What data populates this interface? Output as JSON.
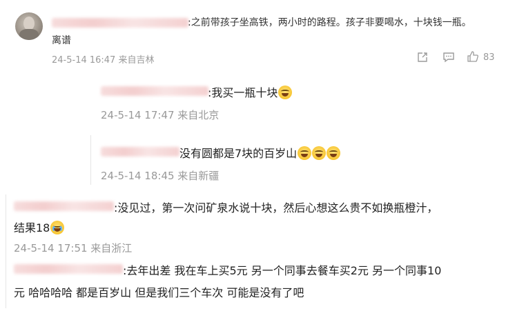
{
  "comments": [
    {
      "text_line1": ":之前带孩子坐高铁，两小时的路程。孩子非要喝水，十块钱一瓶。",
      "text_line2": "离谱",
      "meta": "24-5-14 16:47 来自吉林",
      "like_count": "83",
      "icons": [
        "share-icon",
        "comment-icon",
        "like-icon"
      ]
    },
    {
      "text": ":我买一瓶十块",
      "meta": "24-5-14 17:47 来自北京",
      "emoji": "laugh-cry-emoji"
    },
    {
      "text": "没有圆都是7块的百岁山",
      "meta": "24-5-14 18:45 来自新疆",
      "emoji": "laugh-cry-emoji"
    },
    {
      "text_line1": ":没见过，第一次问矿泉水说十块，然后心想这么贵不如换瓶橙汁，",
      "text_line2": "结果18",
      "meta": "24-5-14 17:51 来自浙江",
      "emoji": "crying-emoji"
    },
    {
      "text_line1": ":去年出差 我在车上买5元 另一个同事去餐车买2元 另一个同事10",
      "text_line2": "元 哈哈哈哈 都是百岁山 但是我们三个车次 可能是没有了吧"
    }
  ]
}
